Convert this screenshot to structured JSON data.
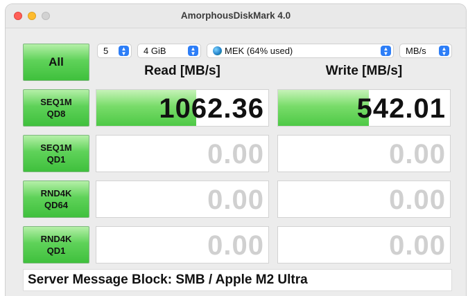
{
  "window": {
    "title": "AmorphousDiskMark 4.0"
  },
  "controls": {
    "all_label": "All",
    "count": "5",
    "size": "4 GiB",
    "target": "MEK (64% used)",
    "unit": "MB/s"
  },
  "headers": {
    "read": "Read [MB/s]",
    "write": "Write [MB/s]"
  },
  "tests": [
    {
      "line1": "SEQ1M",
      "line2": "QD8",
      "read": "1062.36",
      "write": "542.01",
      "read_fill": 0.58,
      "write_fill": 0.53
    },
    {
      "line1": "SEQ1M",
      "line2": "QD1",
      "read": "0.00",
      "write": "0.00",
      "read_fill": 0,
      "write_fill": 0
    },
    {
      "line1": "RND4K",
      "line2": "QD64",
      "read": "0.00",
      "write": "0.00",
      "read_fill": 0,
      "write_fill": 0
    },
    {
      "line1": "RND4K",
      "line2": "QD1",
      "read": "0.00",
      "write": "0.00",
      "read_fill": 0,
      "write_fill": 0
    }
  ],
  "status": "Server Message Block: SMB / Apple M2 Ultra",
  "colors": {
    "accent": "#2d7ef7",
    "bar_green": "#4ec946",
    "zero_text": "#d0d0d0"
  },
  "icons": {
    "target": "globe-icon",
    "stepper": "chevron-updown-icon"
  }
}
